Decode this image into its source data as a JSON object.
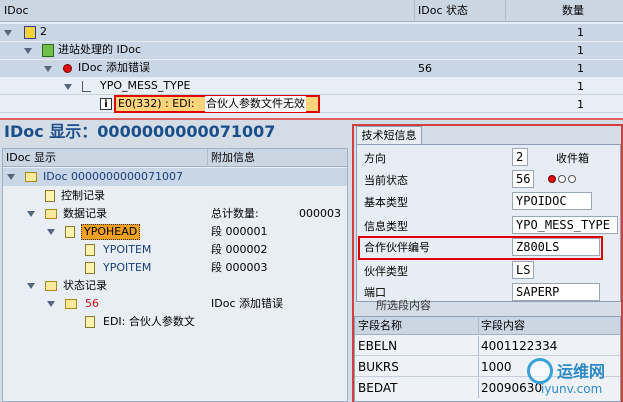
{
  "top_tree": {
    "headers": {
      "name": "IDoc",
      "status": "IDoc 状态",
      "count": "数量"
    },
    "rows": [
      {
        "label": "2",
        "status": "",
        "count": "1"
      },
      {
        "label": "进站处理的 IDoc",
        "status": "",
        "count": "1"
      },
      {
        "label": "IDoc 添加错误",
        "status": "56",
        "count": "1"
      },
      {
        "label": "YPO_MESS_TYPE",
        "status": "",
        "count": "1"
      },
      {
        "label_prefix": "E0(332) : EDI:",
        "label_highlight": "合伙人参数文件无效",
        "status": "",
        "count": "1"
      }
    ]
  },
  "idoc_display": {
    "title": "IDoc 显示：",
    "number": "0000000000071007",
    "columns": {
      "name": "IDoc 显示",
      "extra": "附加信息"
    },
    "tree": [
      {
        "label": "IDoc 0000000000071007",
        "extra": ""
      },
      {
        "label": "控制记录",
        "extra": ""
      },
      {
        "label": "数据记录",
        "extra_label": "总计数量:",
        "extra_value": "000003"
      },
      {
        "label": "YPOHEAD",
        "extra": "段 000001"
      },
      {
        "label": "YPOITEM",
        "extra": "段 000002"
      },
      {
        "label": "YPOITEM",
        "extra": "段 000003"
      },
      {
        "label": "状态记录",
        "extra": ""
      },
      {
        "label": "56",
        "extra": "IDoc 添加错误"
      },
      {
        "label": "EDI: 合伙人参数文",
        "extra": ""
      }
    ]
  },
  "tech_info": {
    "tab": "技术短信息",
    "fields": [
      {
        "label": "方向",
        "value": "2",
        "extra": "收件箱"
      },
      {
        "label": "当前状态",
        "value": "56"
      },
      {
        "label": "基本类型",
        "value": "YPOIDOC"
      },
      {
        "label": "信息类型",
        "value": "YPO_MESS_TYPE"
      },
      {
        "label": "合作伙伴编号",
        "value": "Z800LS"
      },
      {
        "label": "伙伴类型",
        "value": "LS"
      },
      {
        "label": "端口",
        "value": "SAPERP"
      }
    ],
    "section_label": "所选段内容"
  },
  "segment_table": {
    "columns": [
      "字段名称",
      "字段内容"
    ],
    "rows": [
      [
        "EBELN",
        "4001122334"
      ],
      [
        "BUKRS",
        "1000"
      ],
      [
        "BEDAT",
        "20090630"
      ]
    ]
  },
  "watermark": {
    "text": "运维网",
    "url": "iyunv.com"
  },
  "colors": {
    "highlight_border": "#e00000",
    "title_blue": "#1a4f8a",
    "accent_orange": "#f0a020"
  }
}
